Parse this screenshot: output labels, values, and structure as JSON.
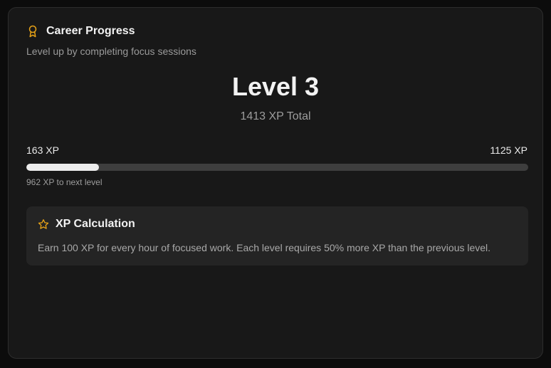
{
  "card": {
    "title": "Career Progress",
    "subtitle": "Level up by completing focus sessions",
    "icon": "award-icon"
  },
  "level": {
    "label": "Level 3",
    "total": "1413 XP Total"
  },
  "progress": {
    "start_label": "163 XP",
    "end_label": "1125 XP",
    "fraction": 0.145,
    "to_next": "962 XP to next level"
  },
  "info": {
    "icon": "star-icon",
    "title": "XP Calculation",
    "text": "Earn 100 XP for every hour of focused work. Each level requires 50% more XP than the previous level."
  },
  "colors": {
    "accent": "#e8a317",
    "background": "#181818",
    "bar_fill": "#ececec",
    "bar_track": "#3e3e3e"
  }
}
